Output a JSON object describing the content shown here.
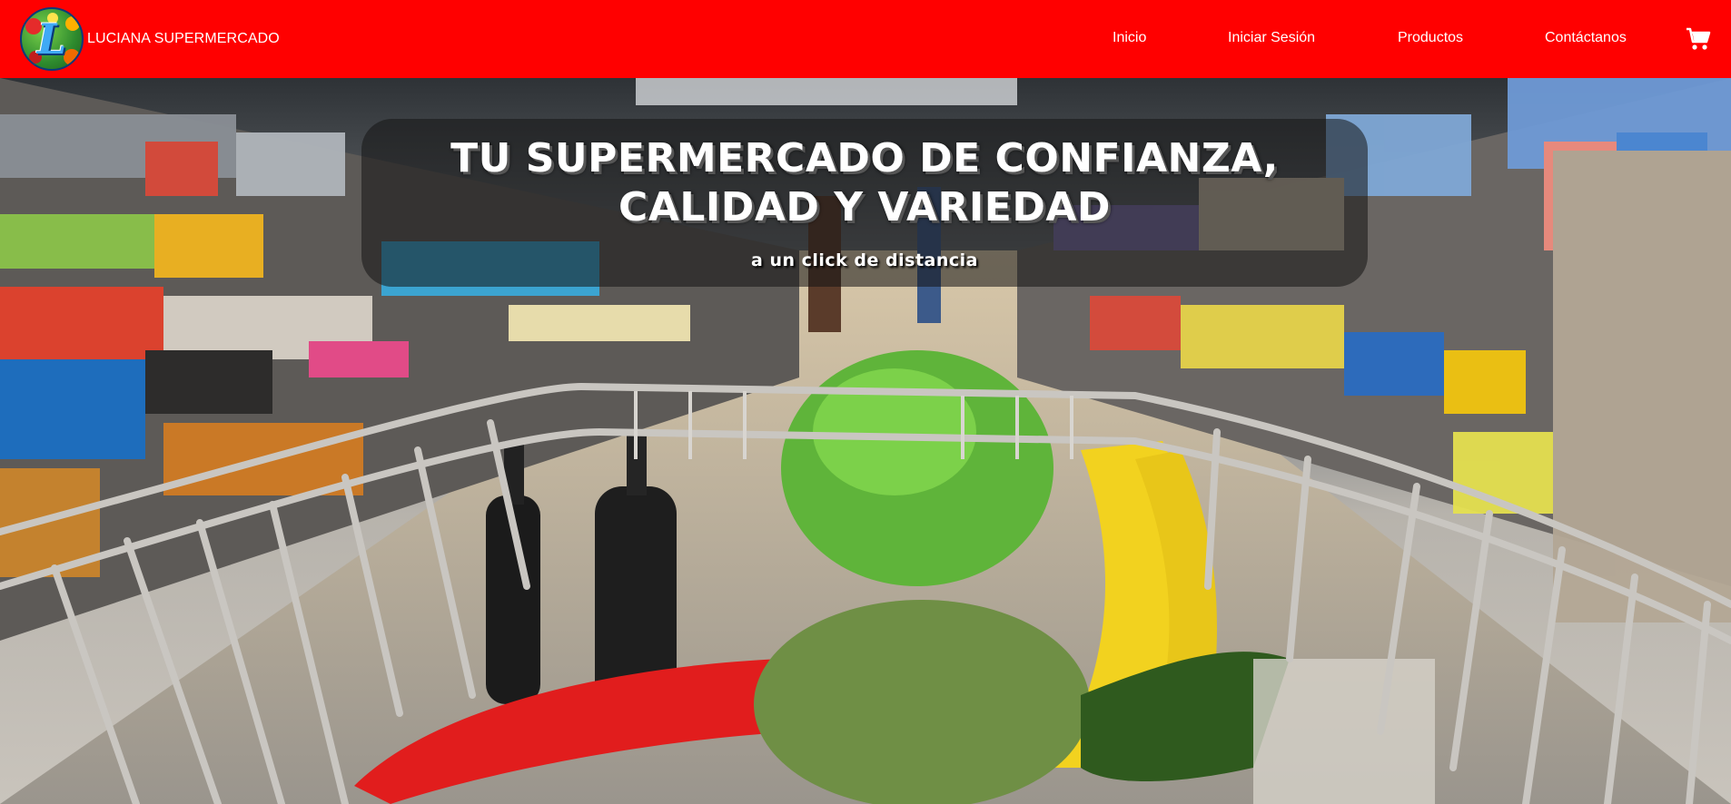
{
  "navbar": {
    "brand": "LUCIANA SUPERMERCADO",
    "logo_letter": "L",
    "background_color": "#ff0000",
    "links": [
      {
        "label": "Inicio"
      },
      {
        "label": "Iniciar Sesión"
      },
      {
        "label": "Productos"
      },
      {
        "label": "Contáctanos"
      }
    ],
    "cart_icon": "shopping-cart-icon"
  },
  "hero": {
    "title_line1": "TU SUPERMERCADO DE CONFIANZA,",
    "title_line2": "CALIDAD Y VARIEDAD",
    "subtitle": "a un click de distancia",
    "image": "shopping-cart-with-groceries-in-supermarket-aisle"
  }
}
